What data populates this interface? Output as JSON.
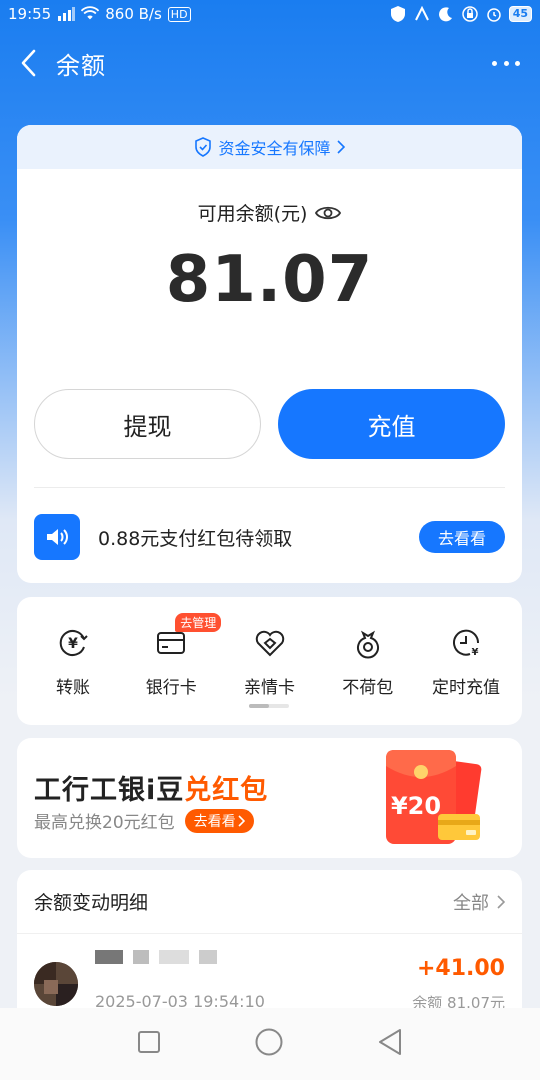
{
  "status_bar": {
    "time": "19:55",
    "network_speed": "860 B/s",
    "battery": "45",
    "signal_label": "4G",
    "hd_label": "HD"
  },
  "nav": {
    "title": "余额"
  },
  "balance": {
    "safety_text": "资金安全有保障",
    "label": "可用余额(元)",
    "amount": "81.07",
    "withdraw_label": "提现",
    "recharge_label": "充值"
  },
  "notice": {
    "text": "0.88元支付红包待领取",
    "button_label": "去看看"
  },
  "quick_actions": [
    {
      "label": "转账",
      "icon": "transfer-yuan-icon"
    },
    {
      "label": "银行卡",
      "icon": "bank-card-icon",
      "badge": "去管理"
    },
    {
      "label": "亲情卡",
      "icon": "family-card-icon"
    },
    {
      "label": "不荷包",
      "icon": "wallet-pouch-icon"
    },
    {
      "label": "定时充值",
      "icon": "scheduled-recharge-icon"
    }
  ],
  "promo": {
    "title_plain": "工行工银i豆",
    "title_highlight": "兑红包",
    "subtitle": "最高兑换20元红包",
    "button_label": "去看看",
    "art_value": "¥20"
  },
  "details": {
    "title": "余额变动明细",
    "all_label": "全部",
    "transaction": {
      "time": "2025-07-03 19:54:10",
      "amount": "+41.00",
      "balance_after": "余额 81.07元"
    }
  },
  "colors": {
    "primary": "#1677ff",
    "accent": "#ff5a00"
  }
}
